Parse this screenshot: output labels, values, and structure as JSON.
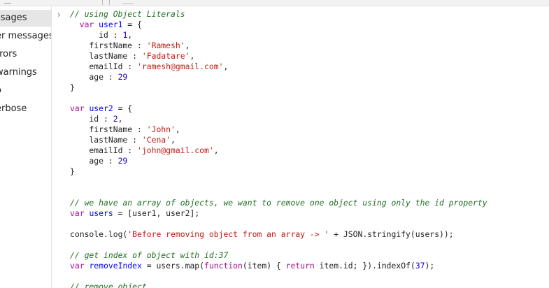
{
  "sidebar": {
    "items": [
      {
        "label": "ssages",
        "selected": true
      },
      {
        "label": "er messages",
        "selected": false
      },
      {
        "label": "rrors",
        "selected": false
      },
      {
        "label": "warnings",
        "selected": false
      },
      {
        "label": "o",
        "selected": false
      },
      {
        "label": "erbose",
        "selected": false
      }
    ]
  },
  "console": {
    "prompt_glyph": "›",
    "code_lines": [
      [
        [
          "cm",
          "// using Object Literals"
        ]
      ],
      [
        [
          "pl",
          "  "
        ],
        [
          "kw",
          "var"
        ],
        [
          "pl",
          " "
        ],
        [
          "var",
          "user1"
        ],
        [
          "pl",
          " = {"
        ]
      ],
      [
        [
          "pl",
          "      id : "
        ],
        [
          "num",
          "1"
        ],
        [
          "pl",
          ","
        ]
      ],
      [
        [
          "pl",
          "    firstName : "
        ],
        [
          "str",
          "'Ramesh'"
        ],
        [
          "pl",
          ","
        ]
      ],
      [
        [
          "pl",
          "    lastName : "
        ],
        [
          "str",
          "'Fadatare'"
        ],
        [
          "pl",
          ","
        ]
      ],
      [
        [
          "pl",
          "    emailId : "
        ],
        [
          "str",
          "'ramesh@gmail.com'"
        ],
        [
          "pl",
          ","
        ]
      ],
      [
        [
          "pl",
          "    age : "
        ],
        [
          "num",
          "29"
        ]
      ],
      [
        [
          "pl",
          "}"
        ]
      ],
      [
        [
          "pl",
          ""
        ]
      ],
      [
        [
          "kw",
          "var"
        ],
        [
          "pl",
          " "
        ],
        [
          "var",
          "user2"
        ],
        [
          "pl",
          " = {"
        ]
      ],
      [
        [
          "pl",
          "    id : "
        ],
        [
          "num",
          "2"
        ],
        [
          "pl",
          ","
        ]
      ],
      [
        [
          "pl",
          "    firstName : "
        ],
        [
          "str",
          "'John'"
        ],
        [
          "pl",
          ","
        ]
      ],
      [
        [
          "pl",
          "    lastName : "
        ],
        [
          "str",
          "'Cena'"
        ],
        [
          "pl",
          ","
        ]
      ],
      [
        [
          "pl",
          "    emailId : "
        ],
        [
          "str",
          "'john@gmail.com'"
        ],
        [
          "pl",
          ","
        ]
      ],
      [
        [
          "pl",
          "    age : "
        ],
        [
          "num",
          "29"
        ]
      ],
      [
        [
          "pl",
          "}"
        ]
      ],
      [
        [
          "pl",
          ""
        ]
      ],
      [
        [
          "pl",
          ""
        ]
      ],
      [
        [
          "cm",
          "// we have an array of objects, we want to remove one object using only the id property"
        ]
      ],
      [
        [
          "kw",
          "var"
        ],
        [
          "pl",
          " "
        ],
        [
          "var",
          "users"
        ],
        [
          "pl",
          " = [user1, user2];"
        ]
      ],
      [
        [
          "pl",
          ""
        ]
      ],
      [
        [
          "pl",
          "console.log("
        ],
        [
          "str",
          "'Before removing object from an array -> '"
        ],
        [
          "pl",
          " + JSON.stringify(users));"
        ]
      ],
      [
        [
          "pl",
          ""
        ]
      ],
      [
        [
          "cm",
          "// get index of object with id:37"
        ]
      ],
      [
        [
          "kw",
          "var"
        ],
        [
          "pl",
          " "
        ],
        [
          "var",
          "removeIndex"
        ],
        [
          "pl",
          " = users.map("
        ],
        [
          "kw",
          "function"
        ],
        [
          "pl",
          "(item) { "
        ],
        [
          "kw",
          "return"
        ],
        [
          "pl",
          " item.id; }).indexOf("
        ],
        [
          "num",
          "37"
        ],
        [
          "pl",
          ");"
        ]
      ],
      [
        [
          "pl",
          ""
        ]
      ],
      [
        [
          "cm",
          "// remove object"
        ]
      ]
    ]
  }
}
